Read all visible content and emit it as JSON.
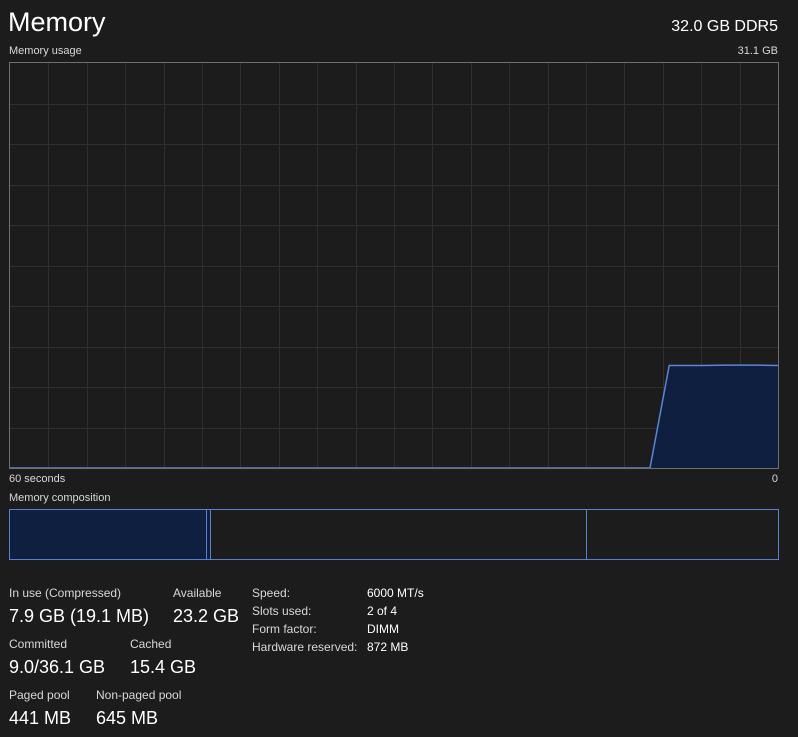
{
  "header": {
    "title": "Memory",
    "capacity": "32.0 GB DDR5"
  },
  "usage_graph": {
    "label": "Memory usage",
    "max_label": "31.1 GB",
    "time_label": "60 seconds",
    "min_label": "0"
  },
  "composition": {
    "label": "Memory composition"
  },
  "stats": {
    "in_use_label": "In use (Compressed)",
    "in_use_value": "7.9 GB (19.1 MB)",
    "available_label": "Available",
    "available_value": "23.2 GB",
    "committed_label": "Committed",
    "committed_value": "9.0/36.1 GB",
    "cached_label": "Cached",
    "cached_value": "15.4 GB",
    "paged_pool_label": "Paged pool",
    "paged_pool_value": "441 MB",
    "non_paged_pool_label": "Non-paged pool",
    "non_paged_pool_value": "645 MB"
  },
  "specs": {
    "speed_label": "Speed:",
    "speed_value": "6000 MT/s",
    "slots_label": "Slots used:",
    "slots_value": "2 of 4",
    "form_factor_label": "Form factor:",
    "form_factor_value": "DIMM",
    "hw_reserved_label": "Hardware reserved:",
    "hw_reserved_value": "872 MB"
  },
  "chart_data": {
    "type": "area",
    "x": [
      60,
      10,
      8.5,
      6,
      4,
      3,
      1.5,
      0
    ],
    "values": [
      0,
      0,
      25.3,
      25.3,
      25.4,
      25.4,
      25.4,
      25.3
    ],
    "xlabel": "60 seconds",
    "ylabel": "Memory usage",
    "ylim": [
      0,
      100
    ],
    "xlim": [
      60,
      0
    ],
    "grid": true,
    "colors": {
      "line": "#5b85d6",
      "fill": "#0f1f3f",
      "grid": "#2f2f2f",
      "border": "#6f6f6f"
    }
  }
}
